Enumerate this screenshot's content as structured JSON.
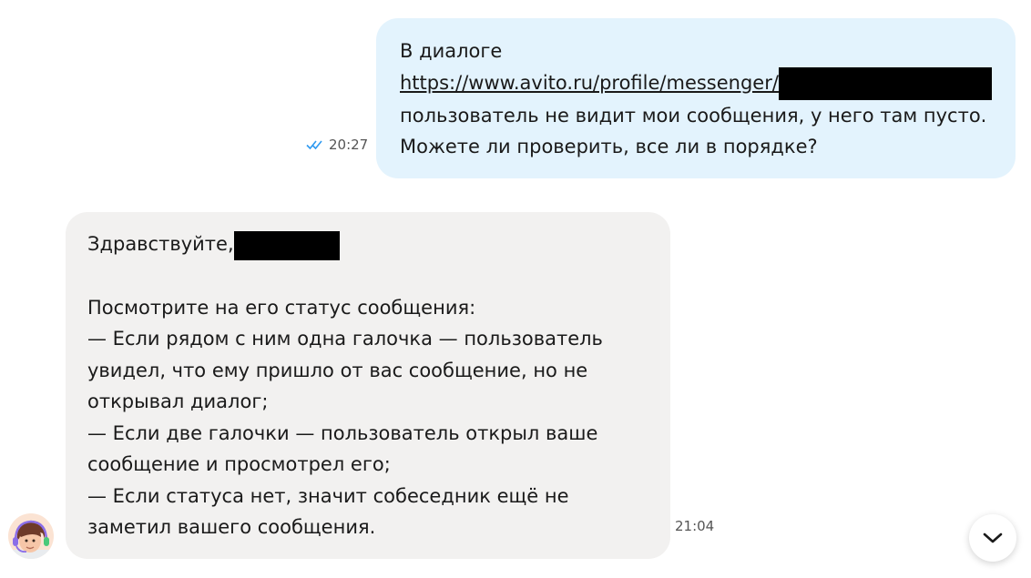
{
  "outgoing": {
    "lines": [
      "В диалоге",
      "https://www.avito.ru/profile/messenger/",
      "пользователь не видит мои сообщения, у него там пусто.",
      "Можете ли проверить, все ли в порядке?"
    ],
    "time": "20:27",
    "status_icon": "double-check-icon"
  },
  "incoming": {
    "greeting": "Здравствуйте,",
    "lines": [
      "Посмотрите на его статус сообщения:",
      "— Если рядом с ним одна галочка — пользователь",
      "увидел, что ему пришло от вас сообщение, но не",
      "открывал диалог;",
      "— Если две галочки — пользователь открыл ваше",
      "сообщение и просмотрел его;",
      "— Если статуса нет, значит собеседник ещё не",
      "заметил вашего сообщения."
    ],
    "time": "21:04",
    "avatar_icon": "support-agent-avatar"
  },
  "scroll_button_icon": "chevron-down-icon",
  "colors": {
    "outgoing_bubble": "#e3f3fd",
    "incoming_bubble": "#f2f1f0",
    "check_blue": "#2f9af0"
  }
}
